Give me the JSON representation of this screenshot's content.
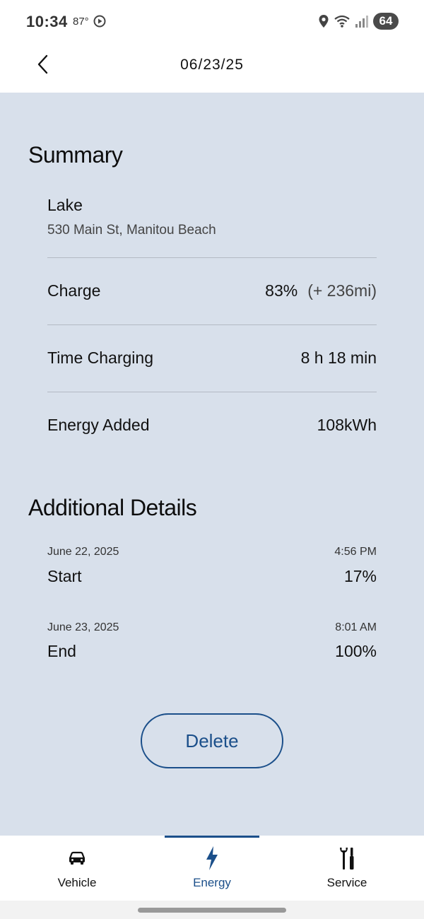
{
  "status_bar": {
    "time": "10:34",
    "temperature": "87°",
    "battery": "64",
    "icons": [
      "play-circle-icon",
      "location-icon",
      "wifi-icon",
      "signal-icon",
      "battery-icon"
    ]
  },
  "header": {
    "title": "06/23/25",
    "back_icon": "chevron-left-icon"
  },
  "summary": {
    "title": "Summary",
    "location_name": "Lake",
    "location_address": "530 Main St, Manitou Beach",
    "charge_label": "Charge",
    "charge_value": "83%",
    "charge_range": "(+ 236mi)",
    "time_label": "Time Charging",
    "time_value": "8 h 18 min",
    "energy_label": "Energy Added",
    "energy_value": "108kWh"
  },
  "details": {
    "title": "Additional Details",
    "start": {
      "date": "June 22, 2025",
      "time": "4:56 PM",
      "label": "Start",
      "value": "17%"
    },
    "end": {
      "date": "June 23, 2025",
      "time": "8:01 AM",
      "label": "End",
      "value": "100%"
    }
  },
  "actions": {
    "delete_label": "Delete"
  },
  "nav": {
    "items": [
      {
        "label": "Vehicle",
        "icon": "car-icon",
        "active": false
      },
      {
        "label": "Energy",
        "icon": "lightning-icon",
        "active": true
      },
      {
        "label": "Service",
        "icon": "tools-icon",
        "active": false
      }
    ]
  },
  "colors": {
    "accent": "#1b4f8a",
    "content_bg": "#d8e0eb",
    "divider": "#b3bac4"
  }
}
